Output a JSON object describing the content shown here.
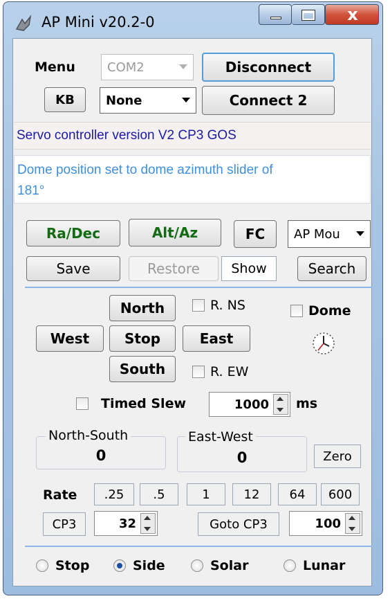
{
  "window": {
    "title": "AP Mini  v20.2-0"
  },
  "top": {
    "menu_label": "Menu",
    "com_value": "COM2",
    "disconnect_label": "Disconnect",
    "kb_label": "KB",
    "none_value": "None",
    "connect2_label": "Connect 2"
  },
  "status": {
    "line1": "Servo controller version V2 CP3 GOS",
    "line2": "Dome position set to dome azimuth slider of 181°"
  },
  "mode": {
    "radec": "Ra/Dec",
    "altaz": "Alt/Az",
    "fc": "FC",
    "mount_value": "AP Mou",
    "save": "Save",
    "restore": "Restore",
    "show": "Show",
    "search": "Search"
  },
  "pad": {
    "north": "North",
    "south": "South",
    "west": "West",
    "east": "East",
    "stop": "Stop",
    "rns": "R. NS",
    "rew": "R. EW",
    "dome": "Dome"
  },
  "timed": {
    "label": "Timed Slew",
    "value": "1000",
    "unit": "ms"
  },
  "ns": {
    "label": "North-South",
    "value": "0"
  },
  "ew": {
    "label": "East-West",
    "value": "0"
  },
  "zero": "Zero",
  "rate": {
    "label": "Rate",
    "values": [
      ".25",
      ".5",
      "1",
      "12",
      "64",
      "600"
    ]
  },
  "cp3": {
    "label": "CP3",
    "value": "32",
    "goto_label": "Goto CP3",
    "goto_value": "100"
  },
  "tracking": {
    "stop": "Stop",
    "side": "Side",
    "solar": "Solar",
    "lunar": "Lunar",
    "selected": "Side"
  }
}
